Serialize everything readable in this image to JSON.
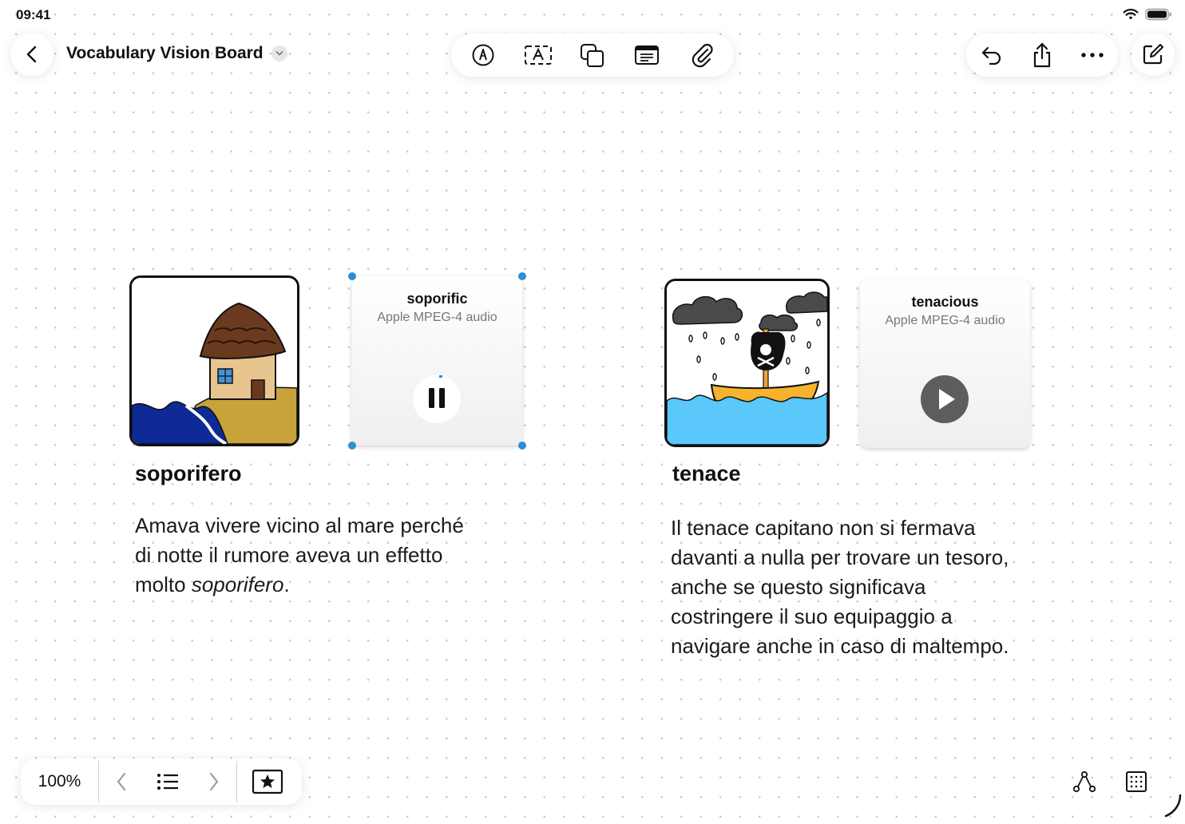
{
  "status_bar": {
    "time": "09:41"
  },
  "header": {
    "back_icon": "chevron-left-icon",
    "title": "Vocabulary Vision Board",
    "title_menu_icon": "chevron-down-icon"
  },
  "toolbar": {
    "tools": [
      "pen-icon",
      "text-box-icon",
      "shapes-icon",
      "note-icon",
      "attachment-icon"
    ]
  },
  "right_toolbar": {
    "tools": [
      "undo-icon",
      "share-icon",
      "more-icon"
    ],
    "compose_icon": "compose-icon"
  },
  "board": {
    "left": {
      "word": "soporifero",
      "audio_title": "soporific",
      "audio_type": "Apple MPEG-4 audio",
      "audio_state": "playing",
      "sentence_1": "Amava vivere vicino al mare perché",
      "sentence_2": "di notte il rumore aveva un effetto",
      "sentence_3_pre": "molto ",
      "sentence_3_italic": "soporifero",
      "sentence_3_post": "."
    },
    "right": {
      "word": "tenace",
      "audio_title": "tenacious",
      "audio_type": "Apple MPEG-4 audio",
      "audio_state": "paused",
      "sentence_lines": [
        "Il tenace capitano non si fermava",
        "davanti a nulla per trovare un tesoro,",
        "anche se questo significava",
        "costringere il suo equipaggio a",
        "navigare anche in caso di maltempo."
      ]
    }
  },
  "bottom_bar": {
    "zoom": "100%",
    "icons": [
      "chevron-left-icon",
      "list-icon",
      "chevron-right-icon",
      "favorite-star-icon"
    ]
  },
  "bottom_right": {
    "icons": [
      "connection-icon",
      "grid-icon"
    ]
  },
  "colors": {
    "selection": "#2a8fd6",
    "play_button": "#5d5d60",
    "sea": "#5ac8fa",
    "sand": "#c8a23a"
  }
}
